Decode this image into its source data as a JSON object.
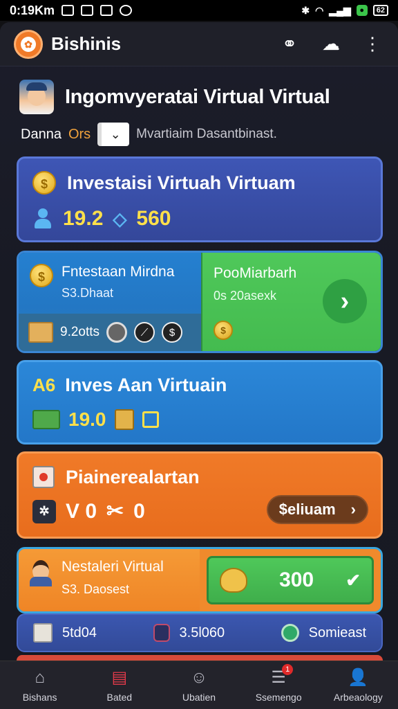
{
  "statusbar": {
    "time": "0:19Km",
    "battery": "62"
  },
  "appbar": {
    "brand": "Bishinis"
  },
  "header": {
    "title": "Ingomvyeratai Virtual Virtual"
  },
  "subrow": {
    "user": "Danna",
    "accent": "Ors",
    "description": "Mvartiaim Dasantbinast."
  },
  "card1": {
    "title": "Investaisi Virtuah Virtuam",
    "value1": "19.2",
    "value2": "560"
  },
  "card2": {
    "left_title": "Fntestaan Mirdna",
    "left_sub": "S3.Dhaat",
    "left_stat": "9.2otts",
    "right_title": "PooMiarbarh",
    "right_sub": "0s 20asexk"
  },
  "card3": {
    "badge": "A6",
    "title": "Inves Aan Virtuain",
    "value": "19.0"
  },
  "card4": {
    "title": "Piainerealartan",
    "value1": "V 0",
    "value2": "0",
    "cta": "$eliuam"
  },
  "card5": {
    "title": "Nestaleri Virtual",
    "sub": "S3. Daosest",
    "value": "300"
  },
  "card6": {
    "stat1": "5td04",
    "stat2": "3.5l060",
    "stat3": "Somieast"
  },
  "bottomnav": {
    "items": [
      {
        "label": "Bishans",
        "icon": "home-icon"
      },
      {
        "label": "Bated",
        "icon": "layers-icon"
      },
      {
        "label": "Ubatien",
        "icon": "chat-icon"
      },
      {
        "label": "Ssemengo",
        "icon": "list-icon",
        "badge": "1"
      },
      {
        "label": "Arbeaology",
        "icon": "profile-icon"
      }
    ]
  },
  "colors": {
    "accent_orange": "#f07a28",
    "card_blue": "#3e56b5",
    "card_green": "#4fc85a",
    "value_yellow": "#ffe04a"
  }
}
